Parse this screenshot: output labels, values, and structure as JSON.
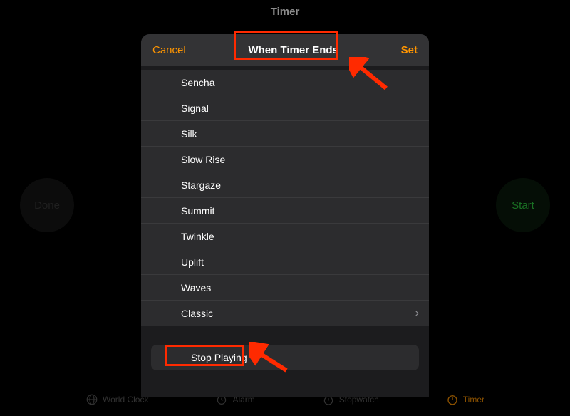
{
  "page_title": "Timer",
  "done_label": "Done",
  "start_label": "Start",
  "tabs": {
    "world_clock": "World Clock",
    "alarm": "Alarm",
    "stopwatch": "Stopwatch",
    "timer": "Timer"
  },
  "sheet": {
    "cancel": "Cancel",
    "title": "When Timer Ends",
    "set": "Set",
    "sounds": [
      "Sencha",
      "Signal",
      "Silk",
      "Slow Rise",
      "Stargaze",
      "Summit",
      "Twinkle",
      "Uplift",
      "Waves",
      "Classic"
    ],
    "stop_playing": "Stop Playing"
  },
  "colors": {
    "accent": "#ff9500",
    "start_green": "#2ecc40",
    "annotation_red": "#ff2a00"
  }
}
